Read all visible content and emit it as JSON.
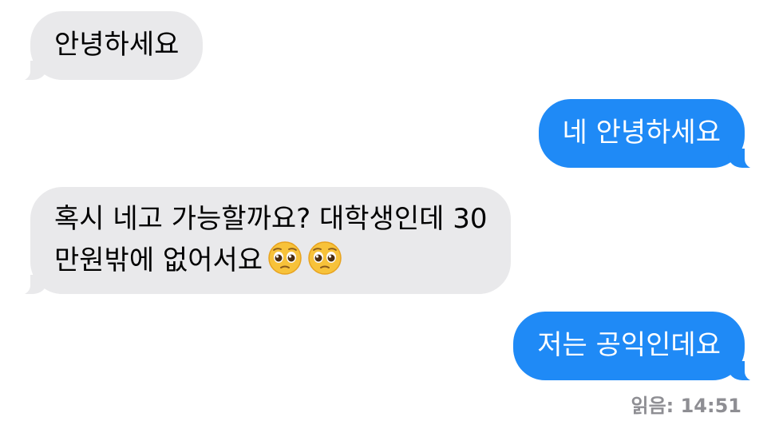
{
  "messages": [
    {
      "side": "in",
      "lines": [
        "안녕하세요"
      ]
    },
    {
      "side": "out",
      "lines": [
        "네 안녕하세요"
      ]
    },
    {
      "side": "in",
      "lines": [
        "혹시 네고 가능할까요? 대학생인데 30",
        "만원밖에 없어서요"
      ],
      "emojis": [
        "pleading-face-emoji",
        "pleading-face-emoji"
      ]
    },
    {
      "side": "out",
      "lines": [
        "저는 공익인데요"
      ]
    }
  ],
  "read_receipt": "읽음: 14:51",
  "colors": {
    "incoming_bubble": "#e9e9eb",
    "outgoing_bubble": "#1f8af6",
    "receipt_text": "#8e8e93"
  }
}
